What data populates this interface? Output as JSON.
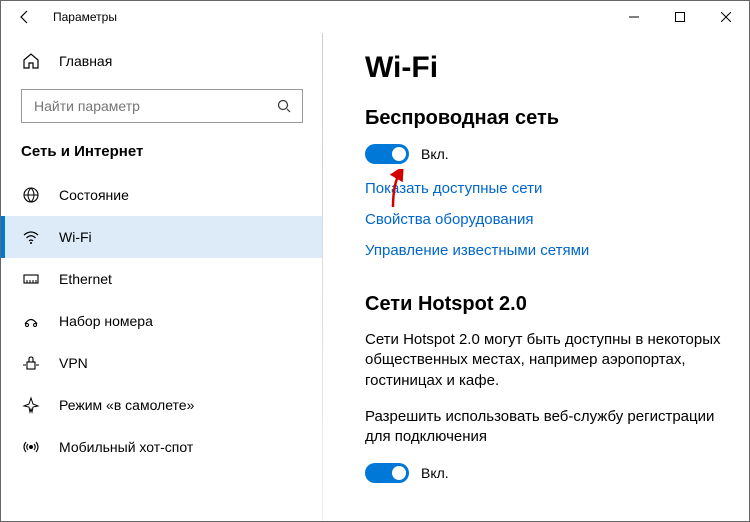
{
  "window": {
    "title": "Параметры"
  },
  "sidebar": {
    "home": "Главная",
    "search_placeholder": "Найти параметр",
    "section": "Сеть и Интернет",
    "items": [
      {
        "label": "Состояние"
      },
      {
        "label": "Wi-Fi"
      },
      {
        "label": "Ethernet"
      },
      {
        "label": "Набор номера"
      },
      {
        "label": "VPN"
      },
      {
        "label": "Режим «в самолете»"
      },
      {
        "label": "Мобильный хот-спот"
      }
    ]
  },
  "content": {
    "title": "Wi-Fi",
    "wireless": {
      "heading": "Беспроводная сеть",
      "toggle_label": "Вкл."
    },
    "links": {
      "show_networks": "Показать доступные сети",
      "hardware_props": "Свойства оборудования",
      "manage_known": "Управление известными сетями"
    },
    "hotspot": {
      "heading": "Сети Hotspot 2.0",
      "description": "Сети Hotspot 2.0 могут быть доступны в некоторых общественных местах, например аэропортах, гостиницах и кафе.",
      "allow_text": "Разрешить использовать веб-службу регистрации для подключения",
      "toggle_label": "Вкл."
    }
  }
}
